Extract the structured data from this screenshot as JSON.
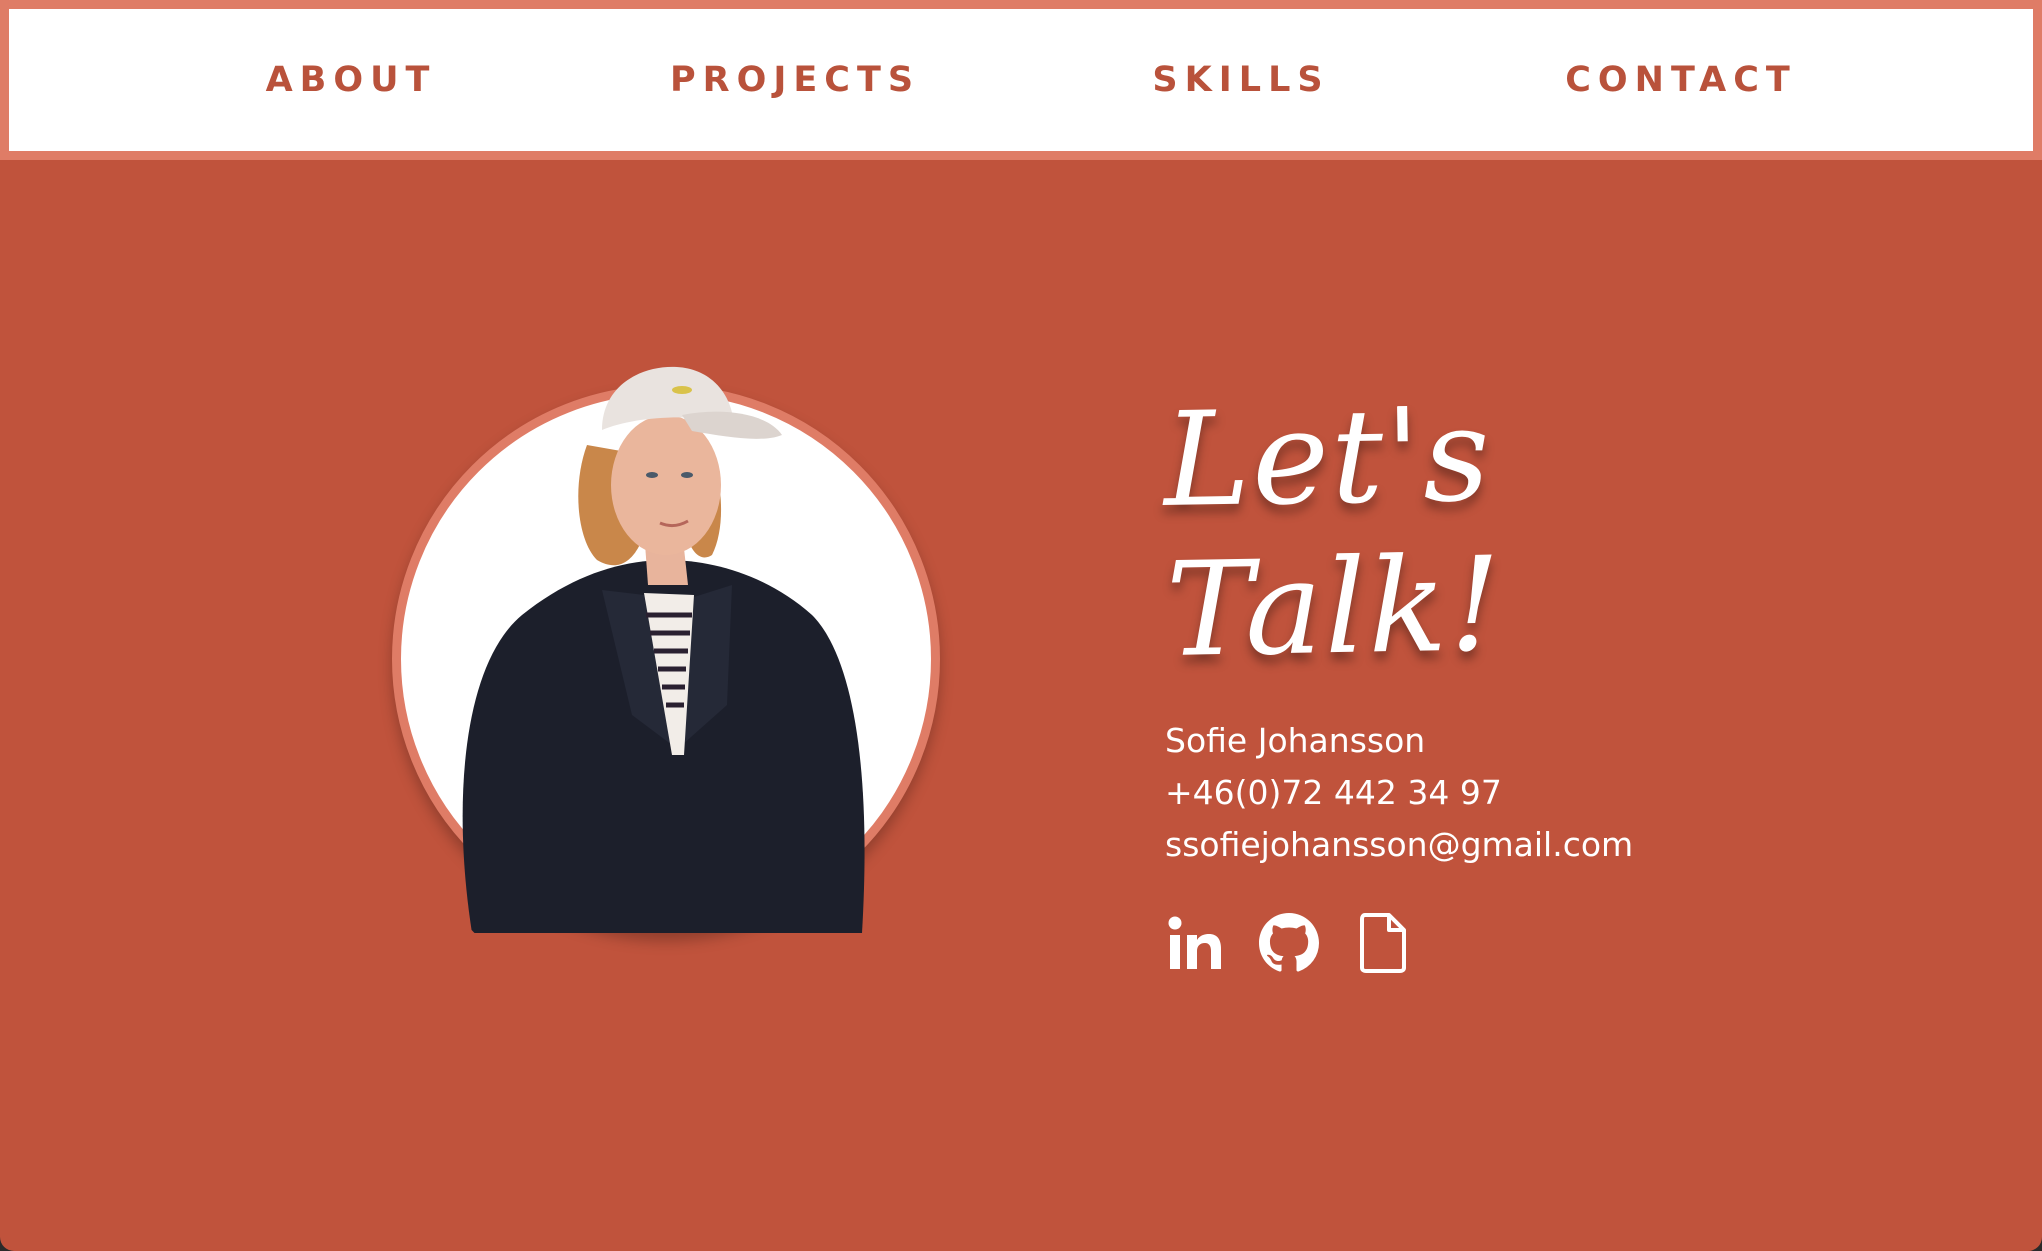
{
  "nav": {
    "items": [
      {
        "label": "ABOUT"
      },
      {
        "label": "PROJECTS"
      },
      {
        "label": "SKILLS"
      },
      {
        "label": "CONTACT"
      }
    ]
  },
  "contact": {
    "heading": "Let's Talk!",
    "name": "Sofie Johansson",
    "phone": "+46(0)72 442 34 97",
    "email": "ssofiejohansson@gmail.com",
    "icons": [
      {
        "name": "linkedin-icon"
      },
      {
        "name": "github-icon"
      },
      {
        "name": "document-icon"
      }
    ]
  },
  "colors": {
    "background": "#c0533c",
    "nav_border": "#df7c66",
    "nav_text": "#b9523b",
    "text": "#ffffff"
  }
}
